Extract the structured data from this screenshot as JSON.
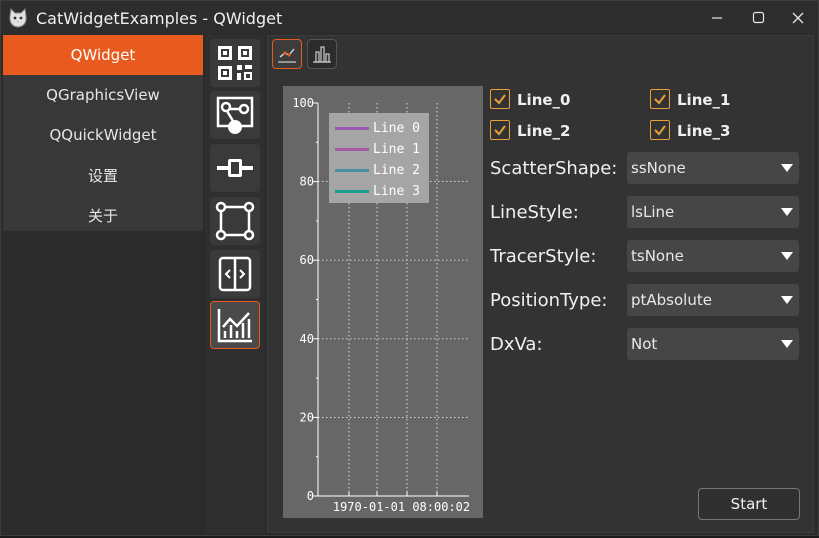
{
  "window": {
    "title": "CatWidgetExamples - QWidget"
  },
  "nav": {
    "items": [
      {
        "label": "QWidget",
        "active": true
      },
      {
        "label": "QGraphicsView",
        "active": false
      },
      {
        "label": "QQuickWidget",
        "active": false
      },
      {
        "label": "设置",
        "active": false
      },
      {
        "label": "关于",
        "active": false
      }
    ]
  },
  "icon_column": [
    "qr-code-icon",
    "node-graph-icon",
    "slider-icon",
    "bounding-box-icon",
    "split-view-icon",
    "line-chart-icon"
  ],
  "tabs": [
    "scatter-line-icon",
    "bar-chart-icon"
  ],
  "plot": {
    "y_ticks": [
      "100",
      "80",
      "60",
      "40",
      "20",
      "0"
    ],
    "x_tick": "1970-01-01  08:00:02",
    "legend": [
      {
        "label": "Line 0",
        "color": "#9b59b6"
      },
      {
        "label": "Line 1",
        "color": "#a35aa6"
      },
      {
        "label": "Line 2",
        "color": "#4a8fa0"
      },
      {
        "label": "Line 3",
        "color": "#1aa090"
      }
    ]
  },
  "chart_data": {
    "type": "line",
    "series": [
      {
        "name": "Line 0",
        "values": []
      },
      {
        "name": "Line 1",
        "values": []
      },
      {
        "name": "Line 2",
        "values": []
      },
      {
        "name": "Line 3",
        "values": []
      }
    ],
    "ylim": [
      0,
      100
    ],
    "grid": true,
    "legend_position": "top-left"
  },
  "checkboxes": [
    {
      "label": "Line_0",
      "checked": true
    },
    {
      "label": "Line_1",
      "checked": true
    },
    {
      "label": "Line_2",
      "checked": true
    },
    {
      "label": "Line_3",
      "checked": true
    }
  ],
  "properties": [
    {
      "label": "ScatterShape:",
      "value": "ssNone"
    },
    {
      "label": "LineStyle:",
      "value": "lsLine"
    },
    {
      "label": "TracerStyle:",
      "value": "tsNone"
    },
    {
      "label": "PositionType:",
      "value": "ptAbsolute"
    },
    {
      "label": "DxVa:",
      "value": "Not"
    }
  ],
  "start_label": "Start",
  "colors": {
    "accent": "#e85a1e",
    "check": "#e8a23a"
  }
}
